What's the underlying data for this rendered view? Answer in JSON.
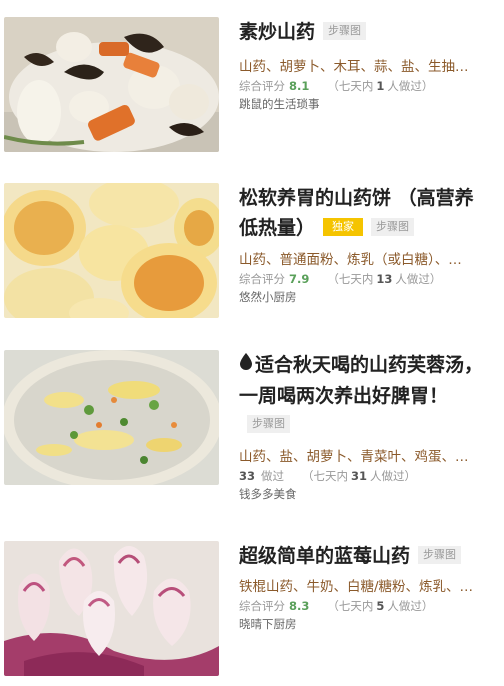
{
  "recipes": [
    {
      "title": "素炒山药",
      "step_tag": "步骤图",
      "ingredients": "山药、胡萝卜、木耳、蒜、盐、生抽…",
      "score_label": "综合评分",
      "score": "8.1",
      "week_prefix": "（七天内",
      "week_count": "1",
      "week_suffix": "人做过）",
      "author": "跳鼠的生活琐事"
    },
    {
      "title": "松软养胃的山药饼 （高营养低热量）",
      "exclusive_tag": "独家",
      "step_tag": "步骤图",
      "ingredients": "山药、普通面粉、炼乳（或白糖）、…",
      "score_label": "综合评分",
      "score": "7.9",
      "week_prefix": "（七天内",
      "week_count": "13",
      "week_suffix": "人做过）",
      "author": "悠然小厨房"
    },
    {
      "title": "适合秋天喝的山药芙蓉汤，一周喝两次养出好脾胃！",
      "step_tag": "步骤图",
      "ingredients": "山药、盐、胡萝卜、青菜叶、鸡蛋、…",
      "cooked_count": "33",
      "cooked_label": "做过",
      "week_prefix": "（七天内",
      "week_count": "31",
      "week_suffix": "人做过）",
      "author": "钱多多美食"
    },
    {
      "title": "超级简单的蓝莓山药",
      "step_tag": "步骤图",
      "ingredients": "铁棍山药、牛奶、白糖/糖粉、炼乳、…",
      "score_label": "综合评分",
      "score": "8.3",
      "week_prefix": "（七天内",
      "week_count": "5",
      "week_suffix": "人做过）",
      "author": "晓晴下厨房"
    }
  ],
  "icons": {
    "drop": "water-drop-icon"
  }
}
